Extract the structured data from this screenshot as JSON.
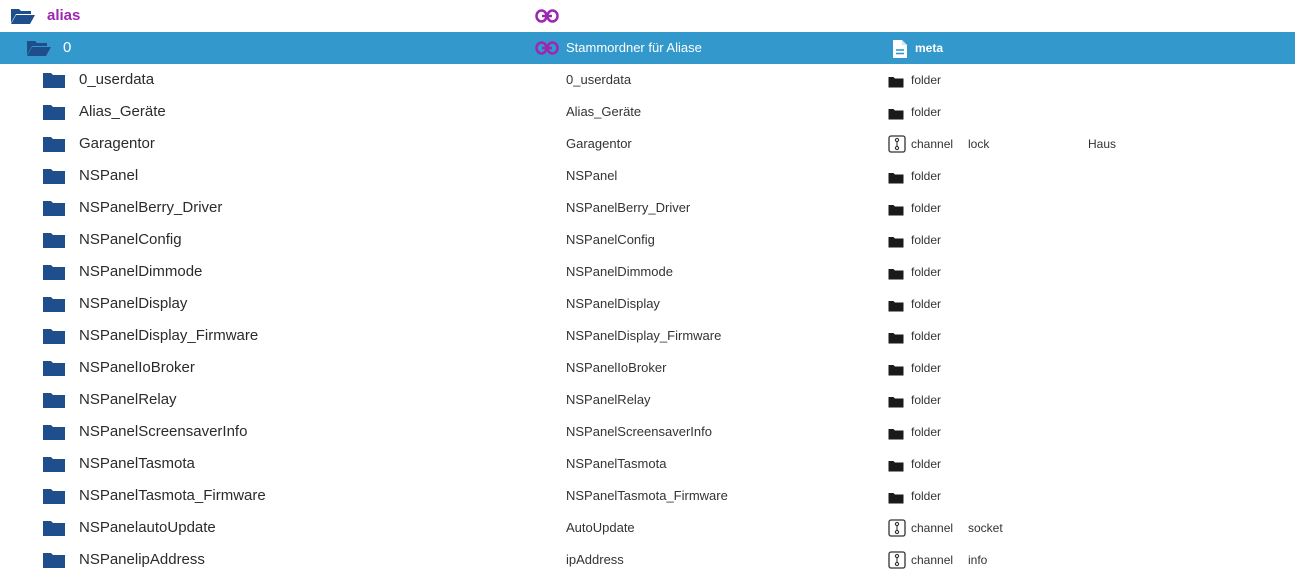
{
  "root": {
    "name": "alias",
    "icons": {
      "folder": "folder-open-icon",
      "link": "link-icon"
    }
  },
  "selected": {
    "name": "0",
    "title": "Stammordner für Aliase",
    "type": "meta",
    "icons": {
      "folder": "folder-open-icon",
      "link": "link-icon",
      "type": "file-icon"
    }
  },
  "rows": [
    {
      "name": "0_userdata",
      "title": "0_userdata",
      "type": "folder",
      "role": "",
      "room": ""
    },
    {
      "name": "Alias_Geräte",
      "title": "Alias_Geräte",
      "type": "folder",
      "role": "",
      "room": ""
    },
    {
      "name": "Garagentor",
      "title": "Garagentor",
      "type": "channel",
      "role": "lock",
      "room": "Haus"
    },
    {
      "name": "NSPanel",
      "title": "NSPanel",
      "type": "folder",
      "role": "",
      "room": ""
    },
    {
      "name": "NSPanelBerry_Driver",
      "title": "NSPanelBerry_Driver",
      "type": "folder",
      "role": "",
      "room": ""
    },
    {
      "name": "NSPanelConfig",
      "title": "NSPanelConfig",
      "type": "folder",
      "role": "",
      "room": ""
    },
    {
      "name": "NSPanelDimmode",
      "title": "NSPanelDimmode",
      "type": "folder",
      "role": "",
      "room": ""
    },
    {
      "name": "NSPanelDisplay",
      "title": "NSPanelDisplay",
      "type": "folder",
      "role": "",
      "room": ""
    },
    {
      "name": "NSPanelDisplay_Firmware",
      "title": "NSPanelDisplay_Firmware",
      "type": "folder",
      "role": "",
      "room": ""
    },
    {
      "name": "NSPanelIoBroker",
      "title": "NSPanelIoBroker",
      "type": "folder",
      "role": "",
      "room": ""
    },
    {
      "name": "NSPanelRelay",
      "title": "NSPanelRelay",
      "type": "folder",
      "role": "",
      "room": ""
    },
    {
      "name": "NSPanelScreensaverInfo",
      "title": "NSPanelScreensaverInfo",
      "type": "folder",
      "role": "",
      "room": ""
    },
    {
      "name": "NSPanelTasmota",
      "title": "NSPanelTasmota",
      "type": "folder",
      "role": "",
      "room": ""
    },
    {
      "name": "NSPanelTasmota_Firmware",
      "title": "NSPanelTasmota_Firmware",
      "type": "folder",
      "role": "",
      "room": ""
    },
    {
      "name": "NSPanelautoUpdate",
      "title": "AutoUpdate",
      "type": "channel",
      "role": "socket",
      "room": ""
    },
    {
      "name": "NSPanelipAddress",
      "title": "ipAddress",
      "type": "channel",
      "role": "info",
      "room": ""
    }
  ],
  "colors": {
    "selected_bg": "#3399cc",
    "folder_icon": "#1f4e8c",
    "alias_text": "#9c27b0"
  }
}
